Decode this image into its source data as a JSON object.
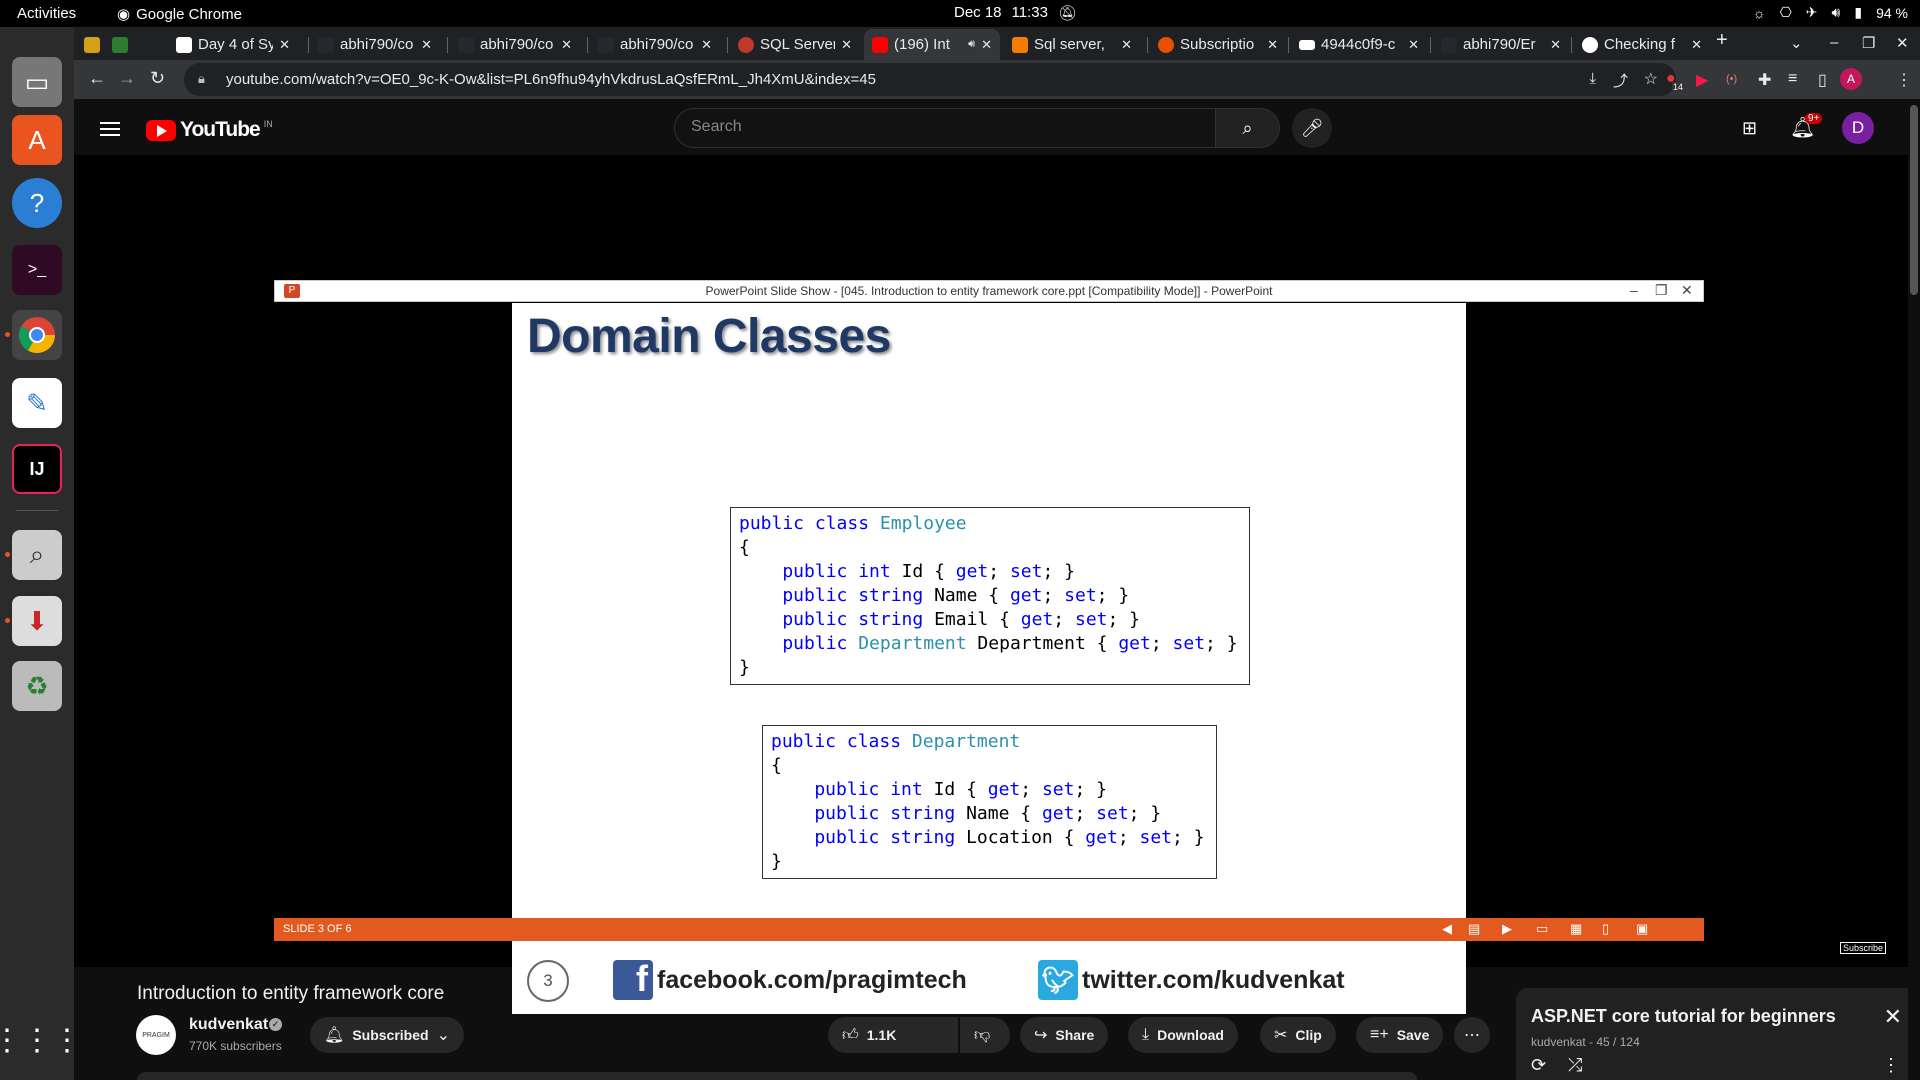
{
  "system": {
    "activities": "Activities",
    "app_name": "Google Chrome",
    "date": "Dec 18",
    "time": "11:33",
    "battery": "94 %"
  },
  "tabs": [
    {
      "title": "",
      "favicon": "#d4a017"
    },
    {
      "title": "",
      "favicon": "#2e7d32"
    },
    {
      "title": "Day 4 of Sy",
      "favicon": "#ffffff"
    },
    {
      "title": "abhi790/co",
      "favicon": "#24292f"
    },
    {
      "title": "abhi790/co",
      "favicon": "#24292f"
    },
    {
      "title": "abhi790/co",
      "favicon": "#24292f"
    },
    {
      "title": "SQL Server",
      "favicon": "#c0392b"
    },
    {
      "title": "(196) Int",
      "favicon": "#ff0000"
    },
    {
      "title": "Sql server,",
      "favicon": "#f57c00"
    },
    {
      "title": "Subscriptio",
      "favicon": "#e65100"
    },
    {
      "title": "4944c0f9-c",
      "favicon": "#ffffff"
    },
    {
      "title": "abhi790/Er",
      "favicon": "#24292f"
    },
    {
      "title": "Checking f",
      "favicon": "#ffffff"
    }
  ],
  "address_bar": {
    "url": "youtube.com/watch?v=OE0_9c-K-Ow&list=PL6n9fhu94yhVkdrusLaQsfERmL_Jh4XmU&index=45"
  },
  "extension_badge": "14",
  "profile_initial": "A",
  "youtube": {
    "logo_text": "YouTube",
    "region": "IN",
    "search_placeholder": "Search",
    "notification_count": "9+",
    "avatar_initial": "D"
  },
  "powerpoint": {
    "window_title": "PowerPoint Slide Show - [045. Introduction to entity framework core.ppt [Compatibility Mode]] - PowerPoint",
    "app_icon_letter": "P",
    "slide_title": "Domain Classes",
    "status": "SLIDE 3 OF 6",
    "slide_number": "3",
    "facebook": "facebook.com/pragimtech",
    "twitter": "twitter.com/kudvenkat",
    "facebook_icon_letter": "f",
    "code_employee": [
      {
        "parts": [
          {
            "t": "public class ",
            "c": "kw"
          },
          {
            "t": "Employee",
            "c": "ty"
          }
        ]
      },
      {
        "parts": [
          {
            "t": "{",
            "c": ""
          }
        ]
      },
      {
        "parts": [
          {
            "t": "    public int ",
            "c": "kw"
          },
          {
            "t": "Id { ",
            "c": ""
          },
          {
            "t": "get",
            "c": "kw"
          },
          {
            "t": "; ",
            "c": ""
          },
          {
            "t": "set",
            "c": "kw"
          },
          {
            "t": "; }",
            "c": ""
          }
        ]
      },
      {
        "parts": [
          {
            "t": "    public string ",
            "c": "kw"
          },
          {
            "t": "Name { ",
            "c": ""
          },
          {
            "t": "get",
            "c": "kw"
          },
          {
            "t": "; ",
            "c": ""
          },
          {
            "t": "set",
            "c": "kw"
          },
          {
            "t": "; }",
            "c": ""
          }
        ]
      },
      {
        "parts": [
          {
            "t": "    public string ",
            "c": "kw"
          },
          {
            "t": "Email { ",
            "c": ""
          },
          {
            "t": "get",
            "c": "kw"
          },
          {
            "t": "; ",
            "c": ""
          },
          {
            "t": "set",
            "c": "kw"
          },
          {
            "t": "; }",
            "c": ""
          }
        ]
      },
      {
        "parts": [
          {
            "t": "    public ",
            "c": "kw"
          },
          {
            "t": "Department",
            "c": "ty"
          },
          {
            "t": " Department { ",
            "c": ""
          },
          {
            "t": "get",
            "c": "kw"
          },
          {
            "t": "; ",
            "c": ""
          },
          {
            "t": "set",
            "c": "kw"
          },
          {
            "t": "; }",
            "c": ""
          }
        ]
      },
      {
        "parts": [
          {
            "t": "}",
            "c": ""
          }
        ]
      }
    ],
    "code_department": [
      {
        "parts": [
          {
            "t": "public class ",
            "c": "kw"
          },
          {
            "t": "Department",
            "c": "ty"
          }
        ]
      },
      {
        "parts": [
          {
            "t": "{",
            "c": ""
          }
        ]
      },
      {
        "parts": [
          {
            "t": "    public int ",
            "c": "kw"
          },
          {
            "t": "Id { ",
            "c": ""
          },
          {
            "t": "get",
            "c": "kw"
          },
          {
            "t": "; ",
            "c": ""
          },
          {
            "t": "set",
            "c": "kw"
          },
          {
            "t": "; }",
            "c": ""
          }
        ]
      },
      {
        "parts": [
          {
            "t": "    public string ",
            "c": "kw"
          },
          {
            "t": "Name { ",
            "c": ""
          },
          {
            "t": "get",
            "c": "kw"
          },
          {
            "t": "; ",
            "c": ""
          },
          {
            "t": "set",
            "c": "kw"
          },
          {
            "t": "; }",
            "c": ""
          }
        ]
      },
      {
        "parts": [
          {
            "t": "    public string ",
            "c": "kw"
          },
          {
            "t": "Location { ",
            "c": ""
          },
          {
            "t": "get",
            "c": "kw"
          },
          {
            "t": "; ",
            "c": ""
          },
          {
            "t": "set",
            "c": "kw"
          },
          {
            "t": "; }",
            "c": ""
          }
        ]
      },
      {
        "parts": [
          {
            "t": "}",
            "c": ""
          }
        ]
      }
    ]
  },
  "subscribe_watermark": "Subscribe",
  "video": {
    "title": "Introduction to entity framework core",
    "channel": "kudvenkat",
    "subscribers": "770K subscribers",
    "channel_avatar_text": "PRAGIM",
    "subscribed_label": "Subscribed",
    "likes": "1.1K",
    "share_label": "Share",
    "download_label": "Download",
    "clip_label": "Clip",
    "save_label": "Save"
  },
  "playlist": {
    "title": "ASP.NET core tutorial for beginners",
    "subtitle": "kudvenkat - 45 / 124"
  }
}
